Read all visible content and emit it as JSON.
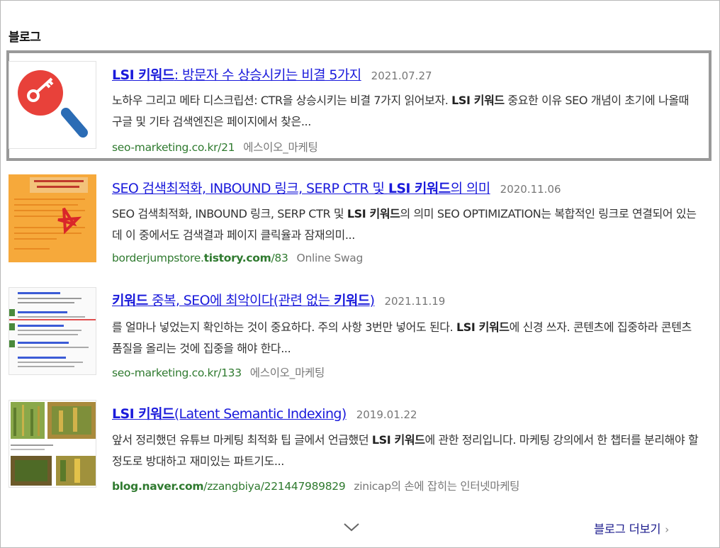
{
  "section": {
    "title": "블로그"
  },
  "results": [
    {
      "title_strong": "LSI 키워드",
      "title_rest": ": 방문자 수 상승시키는 비결 5가지",
      "date": "2021.07.27",
      "desc_pre": "노하우 그리고 메타 디스크립션: CTR을 상승시키는 비결 7가지 읽어보자. ",
      "desc_strong": "LSI 키워드",
      "desc_post": " 중요한 이유 SEO 개념이 초기에 나올때 구글 및 기타 검색엔진은 페이지에서 찾은...",
      "url": "seo-marketing.co.kr/21",
      "author": "에스이오_마케팅",
      "thumb_icon": "magnifier-key-icon"
    },
    {
      "title_pre": "SEO 검색최적화, INBOUND 링크, SERP CTR 및 ",
      "title_strong": "LSI 키워드",
      "title_post": "의 의미",
      "date": "2020.11.06",
      "desc_pre": "SEO 검색최적화, INBOUND 링크, SERP CTR 및 ",
      "desc_strong": "LSI 키워드",
      "desc_post": "의 의미 SEO OPTIMIZATION는 복합적인 링크로 연결되어 있는데 이 중에서도 검색결과 페이지 클릭율과 잠재의미...",
      "url_pre": "borderjumpstore.",
      "url_strong": "tistory.com",
      "url_post": "/83",
      "author": "Online Swag",
      "thumb_icon": "orange-document-thumbnail"
    },
    {
      "title_pre": "키워드",
      "title_rest": " 중복, SEO에 최악이다(관련 없는 ",
      "title_strong": "키워드",
      "title_post": ")",
      "date": "2021.11.19",
      "desc_pre": "를 얼마나 넣었는지 확인하는 것이 중요하다. 주의 사항 3번만 넣어도 된다. ",
      "desc_strong": "LSI 키워드",
      "desc_post": "에 신경 쓰자. 콘텐츠에 집중하라 콘텐츠 품질을 올리는 것에 집중을 해야 한다...",
      "url": "seo-marketing.co.kr/133",
      "author": "에스이오_마케팅",
      "thumb_icon": "webpage-screenshot-thumbnail"
    },
    {
      "title_strong": "LSI 키워드",
      "title_rest": "(Latent Semantic Indexing)",
      "date": "2019.01.22",
      "desc_pre": "앞서 정리했던 유튜브 마케팅 최적화 팁 글에서 언급했던 ",
      "desc_strong": "LSI 키워드",
      "desc_post": "에 관한 정리입니다. 마케팅 강의에서 한 챕터를 분리해야 할 정도로 방대하고 재미있는 파트기도...",
      "url_strong": "blog.naver.com",
      "url_post": "/zzangbiya/221447989829",
      "author": "zinicap의 손에 잡히는 인터넷마케팅",
      "thumb_icon": "plants-photo-thumbnail"
    }
  ],
  "footer": {
    "more_label": "블로그 더보기",
    "chevron": "›"
  },
  "colors": {
    "link": "#1a1adb",
    "url": "#2f7a2f",
    "highlight_border": "#999999"
  }
}
